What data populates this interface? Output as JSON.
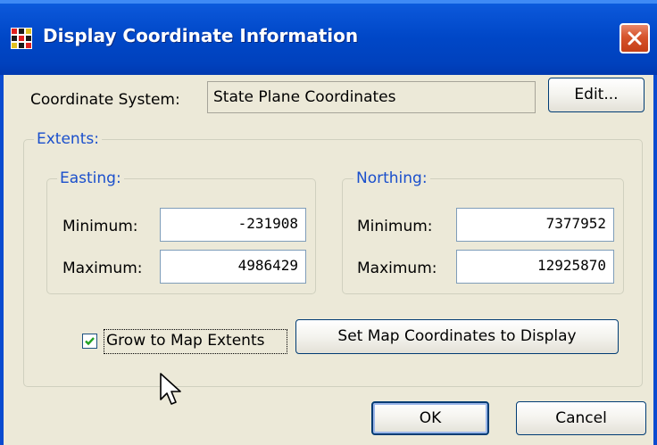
{
  "window": {
    "title": "Display Coordinate Information",
    "icon": "grid-app-icon",
    "close_icon": "close-icon",
    "titlebar_color": "#0047c7"
  },
  "coordinate_system": {
    "label": "Coordinate System:",
    "value": "State Plane Coordinates",
    "edit_button": "Edit..."
  },
  "extents": {
    "label": "Extents:",
    "easting": {
      "label": "Easting:",
      "minimum_label": "Minimum:",
      "minimum_value": "-231908",
      "maximum_label": "Maximum:",
      "maximum_value": "4986429"
    },
    "northing": {
      "label": "Northing:",
      "minimum_label": "Minimum:",
      "minimum_value": "7377952",
      "maximum_label": "Maximum:",
      "maximum_value": "12925870"
    },
    "grow_checkbox": {
      "label": "Grow to Map Extents",
      "checked": true
    },
    "set_map_button": "Set Map Coordinates to Display"
  },
  "footer": {
    "ok_button": "OK",
    "cancel_button": "Cancel"
  },
  "colors": {
    "dialog_bg": "#ece9d8",
    "group_label": "#1a4fcc",
    "checkmark": "#21a121"
  }
}
